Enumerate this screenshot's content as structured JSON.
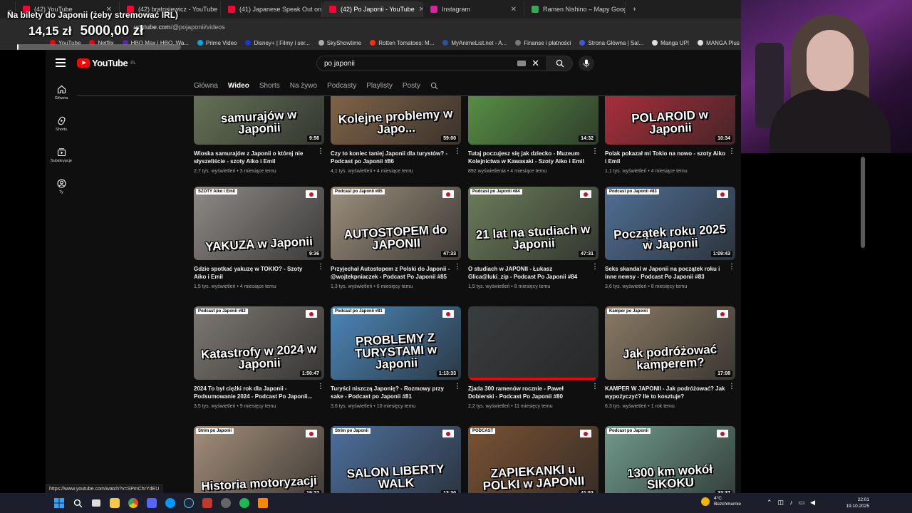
{
  "browser": {
    "tabs": [
      {
        "label": "(42) YouTube",
        "active": false
      },
      {
        "label": "(42) bratosiewicz - YouTube",
        "active": false
      },
      {
        "label": "(41) Japanese Speak Out on the",
        "active": false
      },
      {
        "label": "(42) Po Japonii - YouTube",
        "active": true
      },
      {
        "label": "Instagram",
        "active": false
      },
      {
        "label": "Ramen Nishino – Mapy Google",
        "active": false
      }
    ],
    "new_tab": "+",
    "url_host": "youtube.com",
    "url_path": "/@pojaponii/videos",
    "bookmarks": [
      "YouTube",
      "Netflix",
      "HBO Max | HBO, Wa...",
      "Prime Video",
      "Disney+ | Filmy i ser...",
      "SkyShowtime",
      "Rotten Tomatoes: M...",
      "MyAnimeList.net - A...",
      "Finanse i płatności",
      "Strona Główna | Sal...",
      "Manga UP!",
      "MANGA Plus by SH..."
    ]
  },
  "overlay": {
    "title": "Na bilety do Japonii (żeby stremować IRL)",
    "current": "14,15 zł",
    "goal": "5000,00 zł",
    "progress_fraction": 0.003
  },
  "youtube": {
    "logo": "YouTube",
    "region": "PL",
    "search": {
      "value": "po japonii"
    },
    "sidebar": [
      {
        "label": "Główna",
        "icon": "home-icon"
      },
      {
        "label": "Shorts",
        "icon": "shorts-icon"
      },
      {
        "label": "Subskrypcje",
        "icon": "subscriptions-icon"
      },
      {
        "label": "Ty",
        "icon": "you-icon"
      }
    ],
    "tabs": [
      {
        "label": "Główna",
        "active": false
      },
      {
        "label": "Wideo",
        "active": true
      },
      {
        "label": "Shorts",
        "active": false
      },
      {
        "label": "Na żywo",
        "active": false
      },
      {
        "label": "Podcasty",
        "active": false
      },
      {
        "label": "Playlisty",
        "active": false
      },
      {
        "label": "Posty",
        "active": false
      }
    ],
    "videos": [
      {
        "title": "Wioska samurajów z Japonii o której nie słyszeliście - szoty Aiko i Emil",
        "views": "2,7 tys. wyświetleń",
        "age": "3 miesiące temu",
        "duration": "9:56",
        "thumb_text": "samurajów w Japonii",
        "badge": "",
        "color": "#6d7a5c",
        "flag": false
      },
      {
        "title": "Czy to koniec taniej Japonii dla turystów? - Podcast po Japonii #86",
        "views": "4,1 tys. wyświetleń",
        "age": "4 miesiące temu",
        "duration": "59:00",
        "thumb_text": "Kolejne problemy w Japo...",
        "badge": "",
        "color": "#8a6a4a",
        "flag": false
      },
      {
        "title": "Tutaj poczujesz się jak dziecko - Muzeum Kolejnictwa w Kawasaki - Szoty Aiko i Emil",
        "views": "892 wyświetlenia",
        "age": "4 miesiące temu",
        "duration": "14:32",
        "thumb_text": "",
        "badge": "",
        "color": "#5c9a48",
        "flag": false
      },
      {
        "title": "Polak pokazał mi Tokio na nowo - szoty Aiko i Emil",
        "views": "1,1 tys. wyświetleń",
        "age": "4 miesiące temu",
        "duration": "10:34",
        "thumb_text": "POLAROID w Japonii",
        "badge": "",
        "color": "#b7303c",
        "flag": false
      },
      {
        "title": "Gdzie spotkać yakuzę w TOKIO? - Szoty Aiko i Emil",
        "views": "1,5 tys. wyświetleń",
        "age": "4 miesiące temu",
        "duration": "9:36",
        "thumb_text": "YAKUZA w Japonii",
        "badge": "SZOTY Aiko i Emil",
        "color": "#8e8a86",
        "flag": true
      },
      {
        "title": "Przyjechał Autostopem z Polski do Japonii - @wojtekpniaczek - Podcast Po Japonii #85",
        "views": "1,3 tys. wyświetleń",
        "age": "6 miesięcy temu",
        "duration": "47:33",
        "thumb_text": "AUTOSTOPEM do JAPONII",
        "badge": "Podcast po Japonii #85",
        "color": "#9c8f7c",
        "flag": true
      },
      {
        "title": "O studiach w JAPONII - Łukasz Glica@luki_zip - Podcast Po Japonii #84",
        "views": "1,5 tys. wyświetleń",
        "age": "8 miesięcy temu",
        "duration": "47:31",
        "thumb_text": "21 lat na studiach w Japonii",
        "badge": "Podcast po Japonii #84",
        "color": "#6b7d5a",
        "flag": true
      },
      {
        "title": "Seks skandal w Japonii na początek roku i inne newsy - Podcast Po Japonii #83",
        "views": "3,6 tys. wyświetleń",
        "age": "8 miesięcy temu",
        "duration": "1:09:43",
        "thumb_text": "Początek roku 2025 w Japonii",
        "badge": "Podcast po Japonii #83",
        "color": "#4f6f95",
        "flag": true
      },
      {
        "title": "2024 To był ciężki rok dla Japonii - Podsumowanie 2024 - Podcast Po Japonii...",
        "views": "3,5 tys. wyświetleń",
        "age": "9 miesięcy temu",
        "duration": "1:50:47",
        "thumb_text": "Katastrofy w 2024 w Japonii",
        "badge": "Podcast po Japonii #82",
        "color": "#7d7873",
        "flag": true
      },
      {
        "title": "Turyści niszczą Japonię? - Rozmowy przy sake - Podcast po Japonii #81",
        "views": "3,6 tys. wyświetleń",
        "age": "10 miesięcy temu",
        "duration": "1:13:33",
        "thumb_text": "PROBLEMY Z TURYSTAMI w Japonii",
        "badge": "Podcast po Japonii #81",
        "color": "#4b86b8",
        "flag": true
      },
      {
        "title": "Zjada 300 ramenów rocznie - Paweł Dobierski - Podcast Po Japonii #80",
        "views": "2,2 tys. wyświetleń",
        "age": "11 miesięcy temu",
        "duration": "",
        "thumb_text": "",
        "badge": "",
        "color": "#3a3d3f",
        "flag": false,
        "watched": 0.98
      },
      {
        "title": "KAMPER W JAPONII - Jak podróżować? Jak wypożyczyć? Ile to kosztuje?",
        "views": "6,3 tys. wyświetleń",
        "age": "1 rok temu",
        "duration": "17:08",
        "thumb_text": "Jak podróżować kamperem?",
        "badge": "Kamper po Japonii",
        "color": "#8a7a64",
        "flag": true
      },
      {
        "title": "",
        "views": "",
        "age": "",
        "duration": "19:22",
        "thumb_text": "Historia motoryzacji",
        "badge": "Strim po Japonii",
        "color": "#a38e7a",
        "flag": true
      },
      {
        "title": "",
        "views": "",
        "age": "",
        "duration": "13:30",
        "thumb_text": "SALON LIBERTY WALK",
        "badge": "Strim po Japonii",
        "color": "#4d6f9c",
        "flag": true
      },
      {
        "title": "",
        "views": "",
        "age": "",
        "duration": "41:53",
        "thumb_text": "ZAPIEKANKI u POLKI w JAPONII",
        "badge": "PODCAST",
        "color": "#7a5233",
        "flag": true
      },
      {
        "title": "",
        "views": "",
        "age": "",
        "duration": "33:37",
        "thumb_text": "1300 km wokół SIKOKU",
        "badge": "Podcast po Japonii",
        "color": "#6f9b8c",
        "flag": true
      }
    ],
    "status_url": "https://www.youtube.com/watch?v=SPmChrYdEU"
  },
  "taskbar": {
    "weather_temp": "4°C",
    "weather_desc": "Bezchmurnie",
    "time": "22:01",
    "date": "19.10.2025"
  }
}
